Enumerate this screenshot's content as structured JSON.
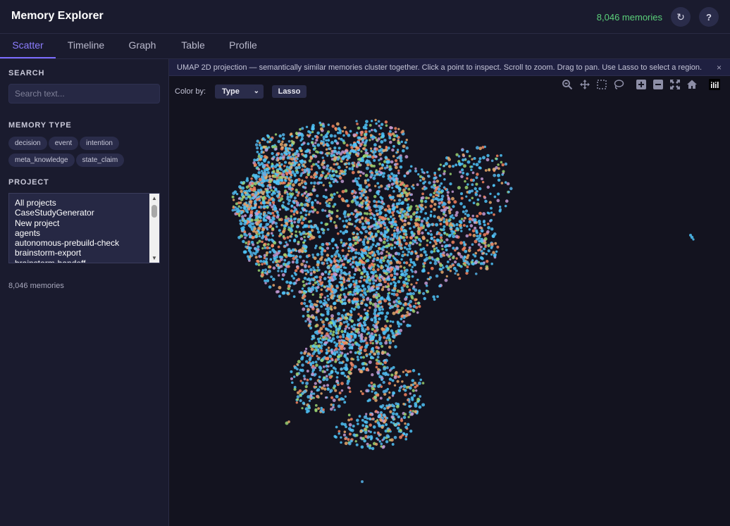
{
  "header": {
    "title": "Memory Explorer",
    "count": "8,046 memories",
    "refresh_icon": "↻",
    "help_icon": "?"
  },
  "tabs": [
    {
      "label": "Scatter",
      "active": true
    },
    {
      "label": "Timeline"
    },
    {
      "label": "Graph"
    },
    {
      "label": "Table"
    },
    {
      "label": "Profile"
    }
  ],
  "sidebar": {
    "search_label": "SEARCH",
    "search_placeholder": "Search text...",
    "type_label": "MEMORY TYPE",
    "types": [
      "decision",
      "event",
      "intention",
      "meta_knowledge",
      "state_claim"
    ],
    "project_label": "PROJECT",
    "projects": [
      "All projects",
      "CaseStudyGenerator",
      "New project",
      "agents",
      "autonomous-prebuild-check",
      "brainstorm-export",
      "brainstorm-handoff"
    ],
    "count": "8,046 memories"
  },
  "main": {
    "banner": "UMAP 2D projection — semantically similar memories cluster together. Click a point to inspect. Scroll to zoom. Drag to pan. Use Lasso to select a region.",
    "banner_close": "×",
    "colorby_label": "Color by:",
    "colorby_value": "Type",
    "lasso_label": "Lasso"
  },
  "modebar_icons": [
    "zoom-icon",
    "pan-icon",
    "box-select-icon",
    "lasso-select-icon",
    "zoom-in-icon",
    "zoom-out-icon",
    "autoscale-icon",
    "reset-axes-icon",
    "plotly-logo-icon"
  ],
  "colors": {
    "accent": "#7b6cff",
    "count_green": "#5bd07a",
    "point_palette": [
      "#4fc3f7",
      "#4fc3f7",
      "#4fc3f7",
      "#56b4e9",
      "#f4845f",
      "#9ad271",
      "#c39bd3",
      "#e6a86b"
    ]
  }
}
